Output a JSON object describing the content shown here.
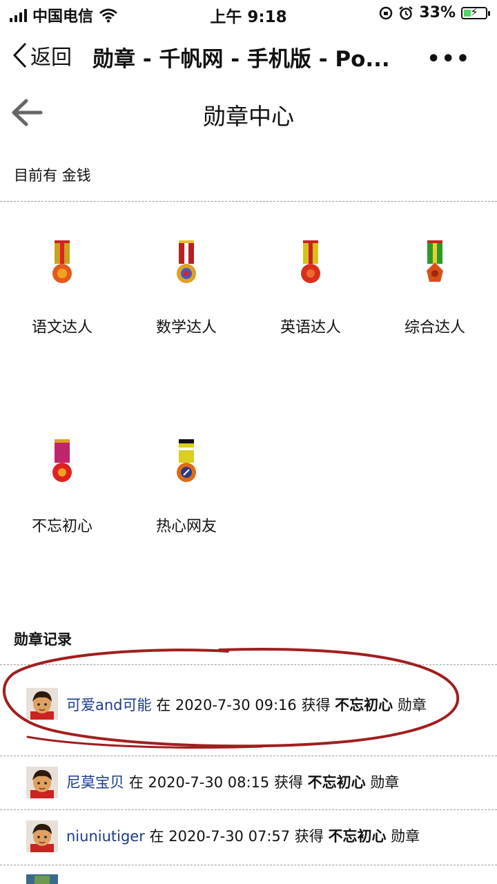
{
  "status_bar": {
    "carrier": "中国电信",
    "time": "上午 9:18",
    "battery": "33%",
    "battery_level": 0.33
  },
  "browser": {
    "back_label": "返回",
    "title": "勋章 - 千帆网 - 手机版 - Po...",
    "more": "•••"
  },
  "page": {
    "title": "勋章中心",
    "money_label": "目前有",
    "money_value": "金钱",
    "medals": [
      {
        "name": "语文达人",
        "ribbon": "#c9a31c",
        "stripe": "#d22",
        "disc": "#e25a1a"
      },
      {
        "name": "数学达人",
        "ribbon": "#b92020",
        "stripe": "#fff",
        "disc": "#3a5bd0"
      },
      {
        "name": "英语达人",
        "ribbon": "#d6c21d",
        "stripe": "#c22",
        "disc": "#d8301a"
      },
      {
        "name": "综合达人",
        "ribbon": "#2a9a2a",
        "stripe": "#e8d030",
        "disc": "#d85018"
      },
      {
        "name": "不忘初心",
        "ribbon": "#c0246a",
        "stripe": "#e0a020",
        "disc": "#e02020"
      },
      {
        "name": "热心网友",
        "ribbon": "#d8cf20",
        "stripe": "#111",
        "disc": "#2a3a8a"
      }
    ],
    "records_title": "勋章记录",
    "records": [
      {
        "user": "可爱and可能",
        "at": "在",
        "datetime": "2020-7-30 09:16",
        "got": "获得",
        "medal": "不忘初心",
        "suffix": "勋章"
      },
      {
        "user": "尼莫宝贝",
        "at": "在",
        "datetime": "2020-7-30 08:15",
        "got": "获得",
        "medal": "不忘初心",
        "suffix": "勋章"
      },
      {
        "user": "niuniutiger",
        "at": "在",
        "datetime": "2020-7-30 07:57",
        "got": "获得",
        "medal": "不忘初心",
        "suffix": "勋章"
      }
    ]
  }
}
